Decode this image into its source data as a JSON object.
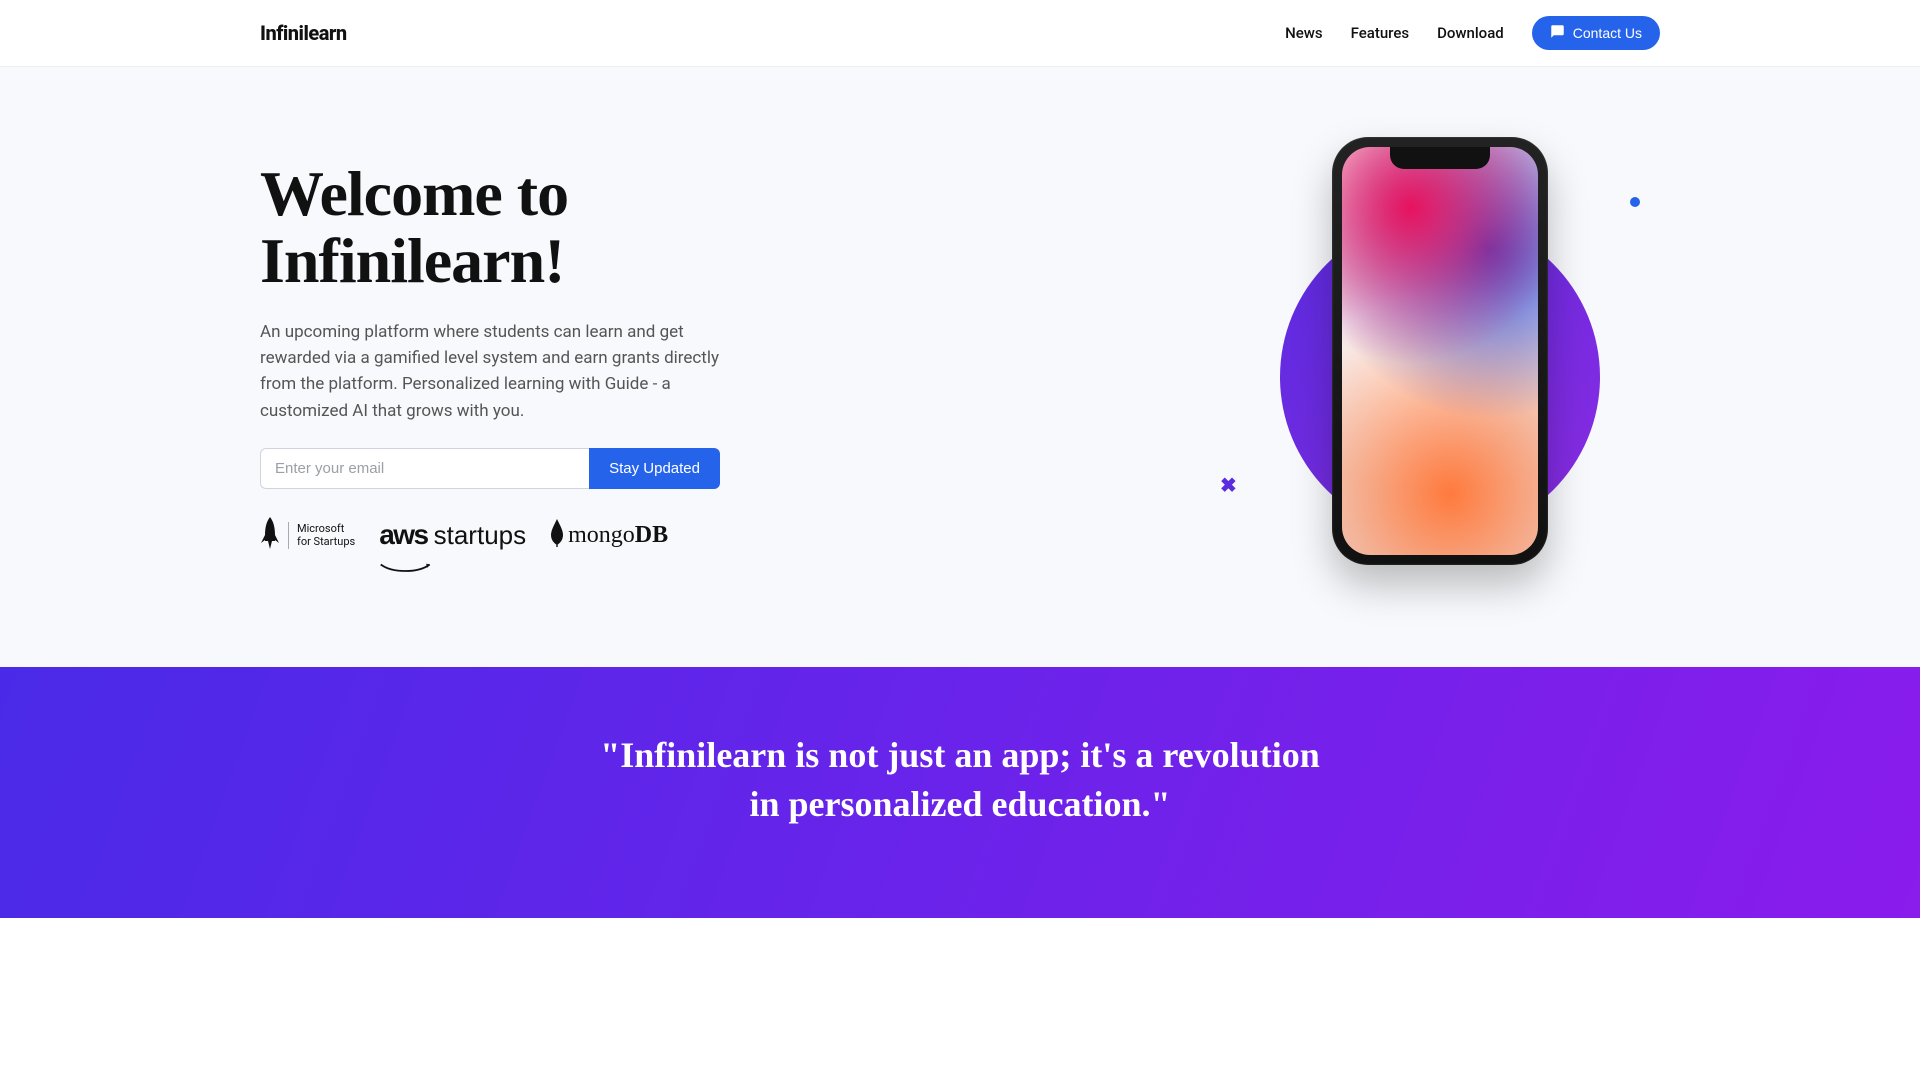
{
  "brand": "Infinilearn",
  "nav": {
    "news": "News",
    "features": "Features",
    "download": "Download",
    "contact": "Contact Us"
  },
  "hero": {
    "title": "Welcome to Infinilearn!",
    "subtitle": "An upcoming platform where students can learn and get rewarded via a gamified level system and earn grants directly from the platform. Personalized learning with Guide - a customized AI that grows with you.",
    "email_placeholder": "Enter your email",
    "email_button": "Stay Updated"
  },
  "partners": {
    "microsoft_line1": "Microsoft",
    "microsoft_line2": "for Startups",
    "aws_word": "aws",
    "aws_startups": "startups",
    "mongo_light": "mongo",
    "mongo_bold": "DB"
  },
  "quote": "\"Infinilearn is not just an app; it's a revolution in personalized education.\"",
  "colors": {
    "primary_blue": "#2563eb",
    "gradient_start": "#4a2ae8",
    "gradient_end": "#8a1cec",
    "hero_bg": "#f8f9fc"
  }
}
